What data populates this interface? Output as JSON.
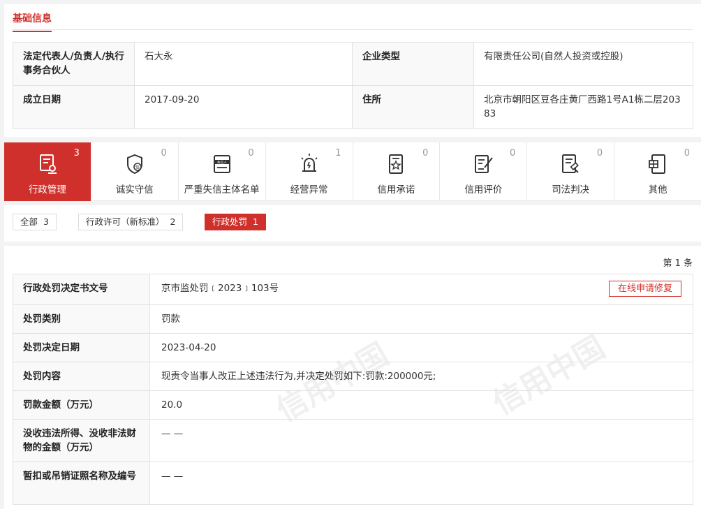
{
  "basic_info": {
    "section_title": "基础信息",
    "rows": [
      {
        "label1": "法定代表人/负责人/执行事务合伙人",
        "value1": "石大永",
        "label2": "企业类型",
        "value2": "有限责任公司(自然人投资或控股)"
      },
      {
        "label1": "成立日期",
        "value1": "2017-09-20",
        "label2": "住所",
        "value2": "北京市朝阳区豆各庄黄厂西路1号A1栋二层20383"
      }
    ]
  },
  "tabs": [
    {
      "label": "行政管理",
      "count": "3",
      "icon": "document-stamp-icon",
      "active": true
    },
    {
      "label": "诚实守信",
      "count": "0",
      "icon": "shield-credit-icon",
      "active": false
    },
    {
      "label": "严重失信主体名单",
      "count": "0",
      "icon": "blacklist-icon",
      "active": false
    },
    {
      "label": "经营异常",
      "count": "1",
      "icon": "alarm-light-icon",
      "active": false
    },
    {
      "label": "信用承诺",
      "count": "0",
      "icon": "certificate-star-icon",
      "active": false
    },
    {
      "label": "信用评价",
      "count": "0",
      "icon": "document-edit-icon",
      "active": false
    },
    {
      "label": "司法判决",
      "count": "0",
      "icon": "document-gavel-icon",
      "active": false
    },
    {
      "label": "其他",
      "count": "0",
      "icon": "document-grid-icon",
      "active": false
    }
  ],
  "filters": [
    {
      "label": "全部",
      "count": "3",
      "active": false
    },
    {
      "label": "行政许可（新标准）",
      "count": "2",
      "active": false
    },
    {
      "label": "行政处罚",
      "count": "1",
      "active": true
    }
  ],
  "detail": {
    "page_count": "第 1 条",
    "repair_button": "在线申请修复",
    "rows": [
      {
        "label": "行政处罚决定书文号",
        "value": "京市监处罚﹝2023﹞103号"
      },
      {
        "label": "处罚类别",
        "value": "罚款"
      },
      {
        "label": "处罚决定日期",
        "value": "2023-04-20"
      },
      {
        "label": "处罚内容",
        "value": "现责令当事人改正上述违法行为,并决定处罚如下:罚款:200000元;"
      },
      {
        "label": "罚款金额（万元）",
        "value": "20.0"
      },
      {
        "label": "没收违法所得、没收非法财物的金额（万元）",
        "value": "— —"
      },
      {
        "label": "暂扣或吊销证照名称及编号",
        "value": "— —"
      }
    ]
  },
  "watermark_text": "信用中国",
  "colors": {
    "accent": "#d0302b"
  }
}
